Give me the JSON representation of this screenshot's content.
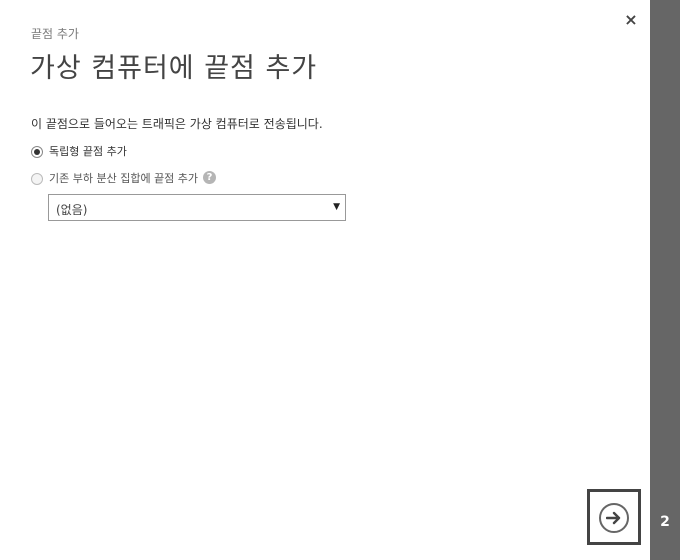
{
  "dialog": {
    "subtitle": "끝점 추가",
    "title": "가상 컴퓨터에 끝점 추가",
    "description": "이 끝점으로 들어오는 트래픽은 가상 컴퓨터로 전송됩니다.",
    "close_label": "×",
    "help_label": "?",
    "options": [
      {
        "label": "독립형 끝점 추가",
        "checked": true
      },
      {
        "label": "기존 부하 분산 집합에 끝점 추가",
        "checked": false
      }
    ],
    "load_balancer_select": {
      "value": "(없음)",
      "arrow": "▼"
    }
  },
  "wizard": {
    "step": "2"
  },
  "colors": {
    "sidebar": "#666666",
    "title_text": "#444444",
    "subtitle_text": "#7a7a7a"
  }
}
